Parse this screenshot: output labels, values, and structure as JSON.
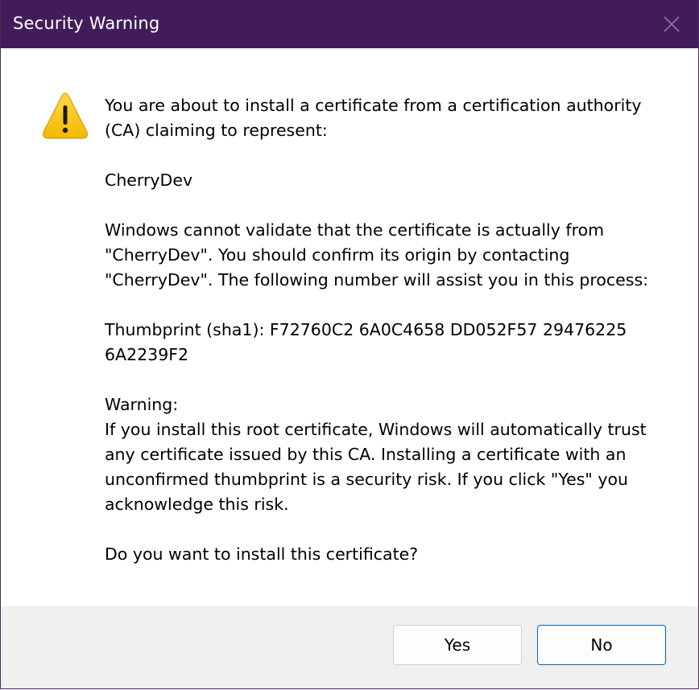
{
  "dialog": {
    "title": "Security Warning",
    "close_icon": "close-icon",
    "warning_icon": "warning-icon",
    "message": {
      "intro": "You are about to install a certificate from a certification authority\n(CA) claiming to represent:",
      "issuer": "CherryDev",
      "validation": "Windows cannot validate that the certificate is actually from\n\"CherryDev\". You should confirm its origin by contacting\n\"CherryDev\". The following number will assist you in this process:",
      "thumbprint": "Thumbprint (sha1): F72760C2 6A0C4658 DD052F57 29476225\n6A2239F2",
      "warning": "Warning:\nIf you install this root certificate, Windows will automatically trust\nany certificate issued by this CA. Installing a certificate with an\nunconfirmed thumbprint is a security risk. If you click \"Yes\" you\nacknowledge this risk.",
      "question": "Do you want to install this certificate?"
    },
    "buttons": {
      "yes_label": "Yes",
      "no_label": "No"
    },
    "colors": {
      "titlebar": "#421c5a",
      "footer": "#f0f0f0",
      "focus_border": "#0067c0",
      "warning_yellow": "#f7c600"
    }
  }
}
